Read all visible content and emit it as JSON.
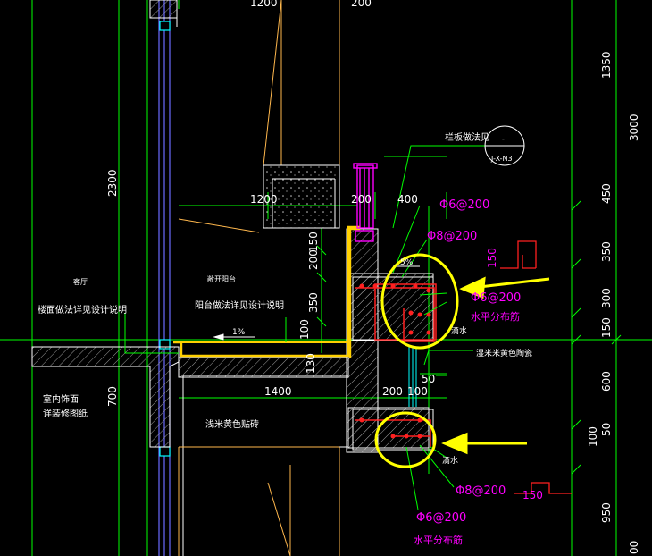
{
  "dimensions": {
    "d_top_1200": "1200",
    "d_top_200": "200",
    "d_mid_1200": "1200",
    "d_mid_200": "200",
    "d_mid_400": "400",
    "d_left_2300": "2300",
    "d_left_700": "700",
    "d_v_150": "150",
    "d_v_200": "200",
    "d_v_350": "350",
    "d_v_100": "100",
    "d_v_130": "130",
    "d_bot_1400": "1400",
    "d_bot_200": "200",
    "d_bot_100": "100",
    "d_r_1350": "1350",
    "d_r_3000": "3000",
    "d_r_450": "450",
    "d_r_350": "350",
    "d_r_300": "300",
    "d_r_150": "150",
    "d_r_600": "600",
    "d_r_100": "100",
    "d_r_950": "950",
    "d_r_00": "00",
    "d_50a": "50",
    "d_50b": "50",
    "d_150_flag": "150",
    "d_150_flag2": "150"
  },
  "labels": {
    "living_room": "客厅",
    "open_balcony": "敞开阳台",
    "floor_note": "楼面做法详见设计说明",
    "balcony_note": "阳台做法详见设计说明",
    "slope_1": "1%",
    "slope_5": "5%",
    "indoor_finish_1": "室内饰面",
    "indoor_finish_2": "详装修图纸",
    "wall_tile": "浅米黄色贴砖",
    "railing_ref": "栏板做法见",
    "detail_ref": "J-X-N3",
    "detail_symbol": "-",
    "rebar_1": "Φ6@200",
    "rebar_2": "Φ8@200",
    "rebar_3": "Φ6@200",
    "horiz_rebar_1": "水平分布筋",
    "drip_1": "滴水",
    "tile_light": "湿米米黄色陶瓷",
    "drip_2": "滴水",
    "rebar_4": "Φ8@200",
    "rebar_5": "Φ6@200",
    "horiz_rebar_2": "水平分布筋"
  },
  "colors": {
    "background": "#000000",
    "green": "#00ff00",
    "white": "#ffffff",
    "yellow": "#ffff00",
    "magenta": "#ff00ff",
    "orange": "#ffb84d",
    "red": "#ff2020",
    "cyan": "#00ffff",
    "blue": "#6a6aff"
  }
}
